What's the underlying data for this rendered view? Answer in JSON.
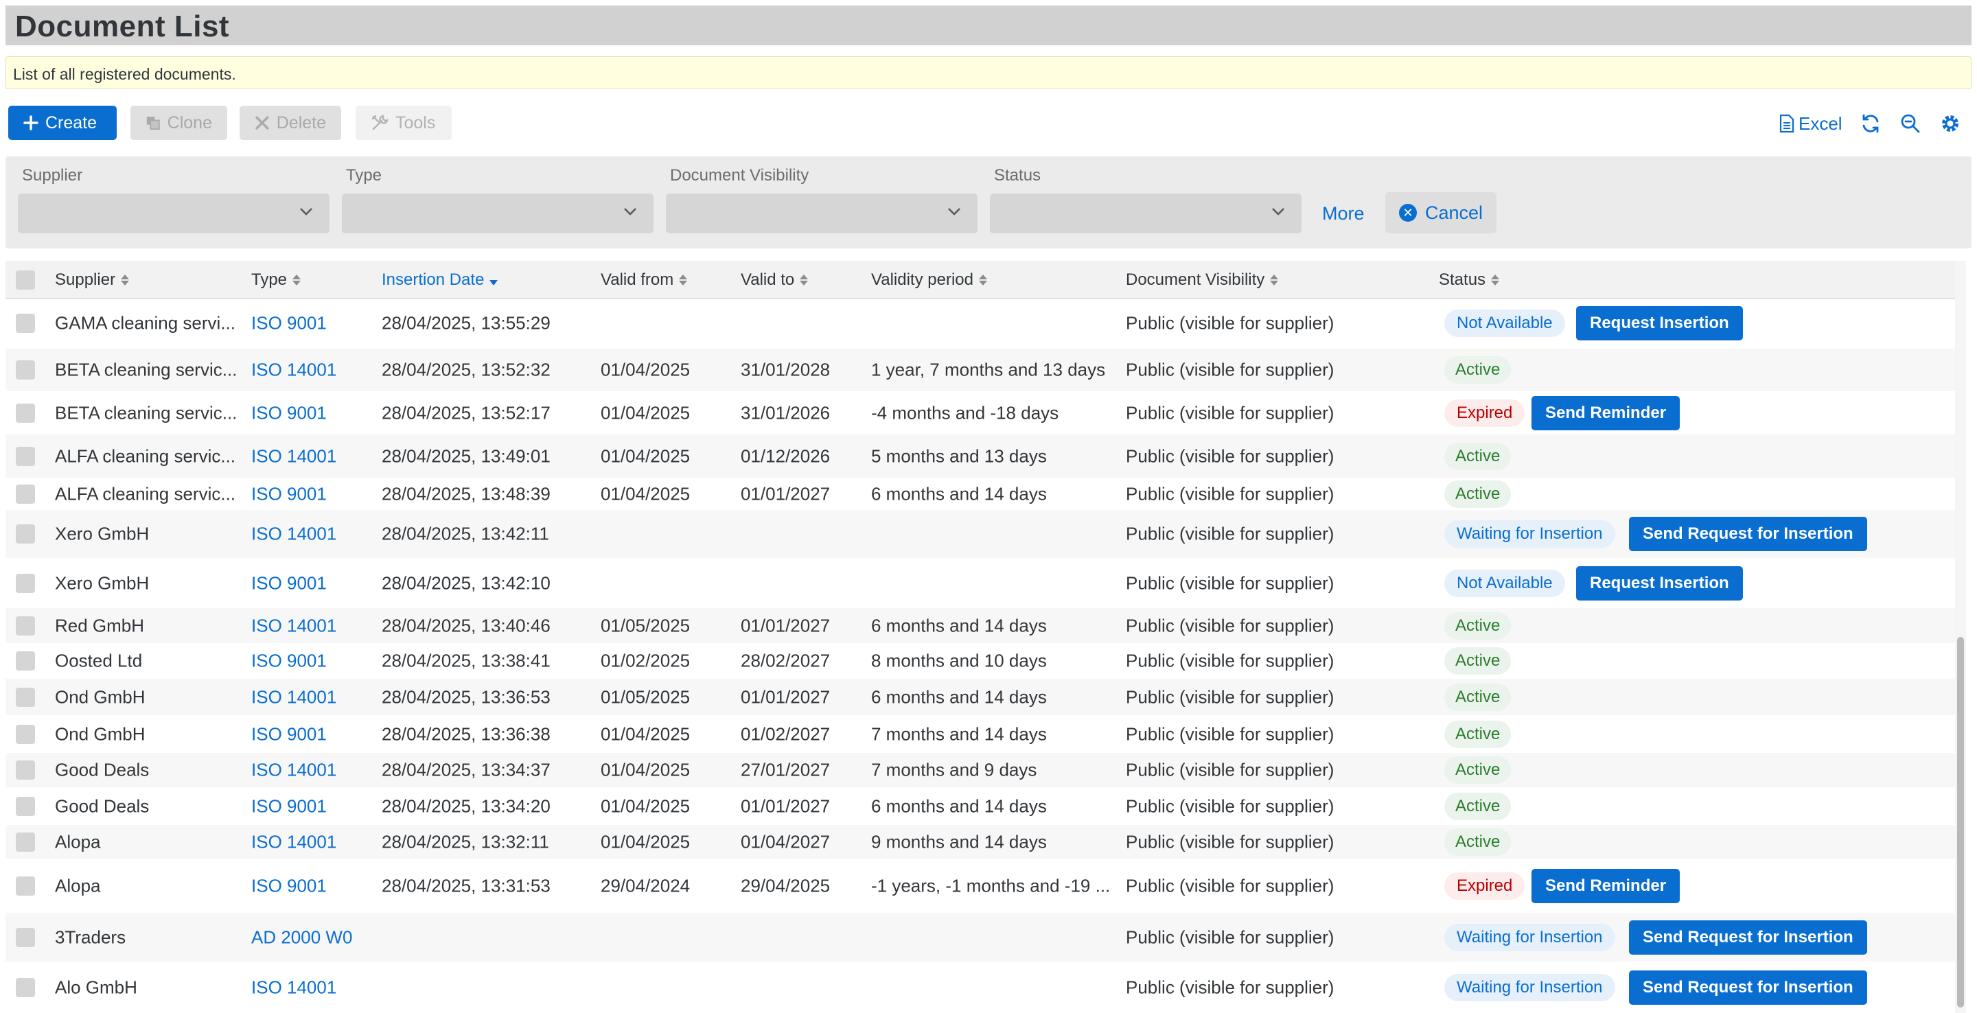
{
  "page": {
    "title": "Document List",
    "info": "List of all registered documents."
  },
  "toolbar": {
    "create": "Create",
    "clone": "Clone",
    "delete": "Delete",
    "tools": "Tools",
    "excel": "Excel",
    "icons": [
      "plus-icon",
      "clone-icon",
      "close-icon",
      "tools-icon",
      "document-icon",
      "refresh-icon",
      "zoom-out-icon",
      "gear-icon"
    ]
  },
  "filters": {
    "supplier_label": "Supplier",
    "type_label": "Type",
    "visibility_label": "Document Visibility",
    "status_label": "Status",
    "supplier_value": "",
    "type_value": "",
    "visibility_value": "",
    "status_value": "",
    "more": "More",
    "cancel": "Cancel"
  },
  "table": {
    "columns": [
      "Supplier",
      "Type",
      "Insertion Date",
      "Valid from",
      "Valid to",
      "Validity period",
      "Document Visibility",
      "Status"
    ],
    "sorted_column": "Insertion Date",
    "rows": [
      {
        "supplier": "GAMA cleaning servi...",
        "type": "ISO 9001",
        "inserted": "28/04/2025, 13:55:29",
        "from": "",
        "to": "",
        "period": "",
        "visibility": "Public (visible for supplier)",
        "status": "Not Available",
        "status_kind": "na",
        "action": "Request Insertion"
      },
      {
        "supplier": "BETA cleaning servic...",
        "type": "ISO 14001",
        "inserted": "28/04/2025, 13:52:32",
        "from": "01/04/2025",
        "to": "31/01/2028",
        "period": "1 year, 7 months and 13 days",
        "visibility": "Public (visible for supplier)",
        "status": "Active",
        "status_kind": "active",
        "action": ""
      },
      {
        "supplier": "BETA cleaning servic...",
        "type": "ISO 9001",
        "inserted": "28/04/2025, 13:52:17",
        "from": "01/04/2025",
        "to": "31/01/2026",
        "period": "-4 months and -18 days",
        "visibility": "Public (visible for supplier)",
        "status": "Expired",
        "status_kind": "expired",
        "action": "Send Reminder"
      },
      {
        "supplier": "ALFA cleaning servic...",
        "type": "ISO 14001",
        "inserted": "28/04/2025, 13:49:01",
        "from": "01/04/2025",
        "to": "01/12/2026",
        "period": "5 months and 13 days",
        "visibility": "Public (visible for supplier)",
        "status": "Active",
        "status_kind": "active",
        "action": ""
      },
      {
        "supplier": "ALFA cleaning servic...",
        "type": "ISO 9001",
        "inserted": "28/04/2025, 13:48:39",
        "from": "01/04/2025",
        "to": "01/01/2027",
        "period": "6 months and 14 days",
        "visibility": "Public (visible for supplier)",
        "status": "Active",
        "status_kind": "active",
        "action": ""
      },
      {
        "supplier": "Xero GmbH",
        "type": "ISO 14001",
        "inserted": "28/04/2025, 13:42:11",
        "from": "",
        "to": "",
        "period": "",
        "visibility": "Public (visible for supplier)",
        "status": "Waiting for Insertion",
        "status_kind": "wait",
        "action": "Send Request for Insertion"
      },
      {
        "supplier": "Xero GmbH",
        "type": "ISO 9001",
        "inserted": "28/04/2025, 13:42:10",
        "from": "",
        "to": "",
        "period": "",
        "visibility": "Public (visible for supplier)",
        "status": "Not Available",
        "status_kind": "na",
        "action": "Request Insertion"
      },
      {
        "supplier": "Red GmbH",
        "type": "ISO 14001",
        "inserted": "28/04/2025, 13:40:46",
        "from": "01/05/2025",
        "to": "01/01/2027",
        "period": "6 months and 14 days",
        "visibility": "Public (visible for supplier)",
        "status": "Active",
        "status_kind": "active",
        "action": ""
      },
      {
        "supplier": "Oosted Ltd",
        "type": "ISO 9001",
        "inserted": "28/04/2025, 13:38:41",
        "from": "01/02/2025",
        "to": "28/02/2027",
        "period": "8 months and 10 days",
        "visibility": "Public (visible for supplier)",
        "status": "Active",
        "status_kind": "active",
        "action": ""
      },
      {
        "supplier": "Ond GmbH",
        "type": "ISO 14001",
        "inserted": "28/04/2025, 13:36:53",
        "from": "01/05/2025",
        "to": "01/01/2027",
        "period": "6 months and 14 days",
        "visibility": "Public (visible for supplier)",
        "status": "Active",
        "status_kind": "active",
        "action": ""
      },
      {
        "supplier": "Ond GmbH",
        "type": "ISO 9001",
        "inserted": "28/04/2025, 13:36:38",
        "from": "01/04/2025",
        "to": "01/02/2027",
        "period": "7 months and 14 days",
        "visibility": "Public (visible for supplier)",
        "status": "Active",
        "status_kind": "active",
        "action": ""
      },
      {
        "supplier": "Good Deals",
        "type": "ISO 14001",
        "inserted": "28/04/2025, 13:34:37",
        "from": "01/04/2025",
        "to": "27/01/2027",
        "period": "7 months and 9 days",
        "visibility": "Public (visible for supplier)",
        "status": "Active",
        "status_kind": "active",
        "action": ""
      },
      {
        "supplier": "Good Deals",
        "type": "ISO 9001",
        "inserted": "28/04/2025, 13:34:20",
        "from": "01/04/2025",
        "to": "01/01/2027",
        "period": "6 months and 14 days",
        "visibility": "Public (visible for supplier)",
        "status": "Active",
        "status_kind": "active",
        "action": ""
      },
      {
        "supplier": "Alopa",
        "type": "ISO 14001",
        "inserted": "28/04/2025, 13:32:11",
        "from": "01/04/2025",
        "to": "01/04/2027",
        "period": "9 months and 14 days",
        "visibility": "Public (visible for supplier)",
        "status": "Active",
        "status_kind": "active",
        "action": ""
      },
      {
        "supplier": "Alopa",
        "type": "ISO 9001",
        "inserted": "28/04/2025, 13:31:53",
        "from": "29/04/2024",
        "to": "29/04/2025",
        "period": "-1 years, -1 months and -19 ...",
        "visibility": "Public (visible for supplier)",
        "status": "Expired",
        "status_kind": "expired",
        "action": "Send Reminder"
      },
      {
        "supplier": "3Traders",
        "type": "AD 2000 W0",
        "inserted": "",
        "from": "",
        "to": "",
        "period": "",
        "visibility": "Public (visible for supplier)",
        "status": "Waiting for Insertion",
        "status_kind": "wait",
        "action": "Send Request for Insertion"
      },
      {
        "supplier": "Alo GmbH",
        "type": "ISO 14001",
        "inserted": "",
        "from": "",
        "to": "",
        "period": "",
        "visibility": "Public (visible for supplier)",
        "status": "Waiting for Insertion",
        "status_kind": "wait",
        "action": "Send Request for Insertion"
      }
    ]
  }
}
